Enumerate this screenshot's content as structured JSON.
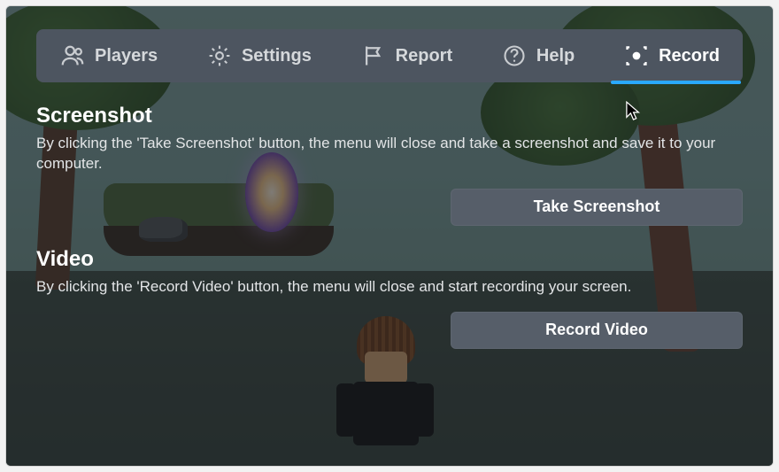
{
  "tabs": {
    "players": "Players",
    "settings": "Settings",
    "report": "Report",
    "help": "Help",
    "record": "Record"
  },
  "active_tab": "record",
  "sections": {
    "screenshot": {
      "heading": "Screenshot",
      "description": "By clicking the 'Take Screenshot' button, the menu will close and take a screenshot and save it to your computer.",
      "button_label": "Take Screenshot"
    },
    "video": {
      "heading": "Video",
      "description": "By clicking the 'Record Video' button, the menu will close and start recording your screen.",
      "button_label": "Record Video"
    }
  }
}
